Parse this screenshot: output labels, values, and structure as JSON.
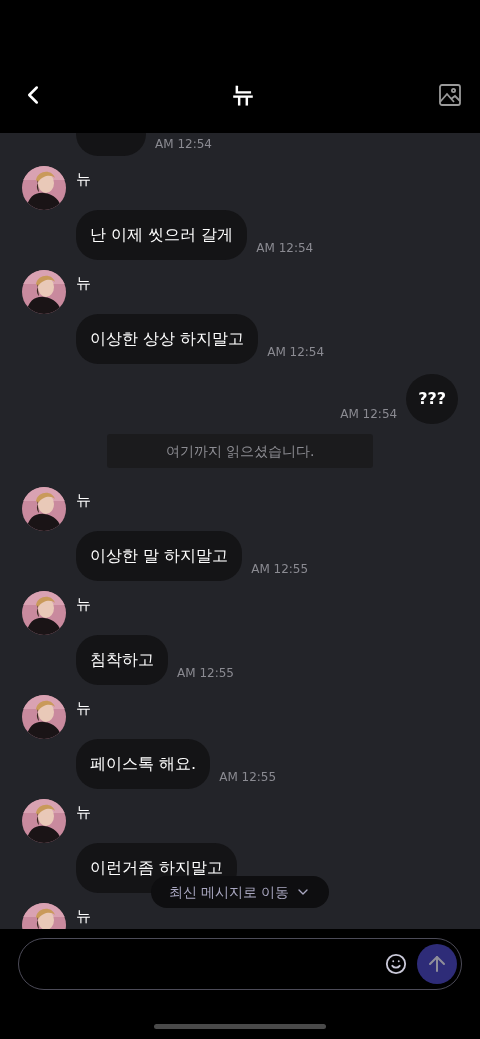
{
  "header": {
    "title": "뉴"
  },
  "messages": [
    {
      "kind": "incoming",
      "time": "AM 12:54"
    },
    {
      "kind": "incoming",
      "sender": "뉴",
      "text": "난 이제 씻으러 갈게",
      "time": "AM 12:54"
    },
    {
      "kind": "incoming",
      "sender": "뉴",
      "text": "이상한 상상 하지말고",
      "time": "AM 12:54"
    },
    {
      "kind": "outgoing",
      "text": "???",
      "time": "AM 12:54"
    },
    {
      "kind": "read_marker",
      "text": "여기까지 읽으셨습니다."
    },
    {
      "kind": "incoming",
      "sender": "뉴",
      "text": "이상한 말 하지말고",
      "time": "AM 12:55"
    },
    {
      "kind": "incoming",
      "sender": "뉴",
      "text": "침착하고",
      "time": "AM 12:55"
    },
    {
      "kind": "incoming",
      "sender": "뉴",
      "text": "페이스톡 해요.",
      "time": "AM 12:55"
    },
    {
      "kind": "incoming",
      "sender": "뉴",
      "text": "이런거좀 하지말고"
    },
    {
      "kind": "incoming",
      "sender": "뉴"
    }
  ],
  "jump_button": {
    "label": "최신 메시지로 이동"
  }
}
